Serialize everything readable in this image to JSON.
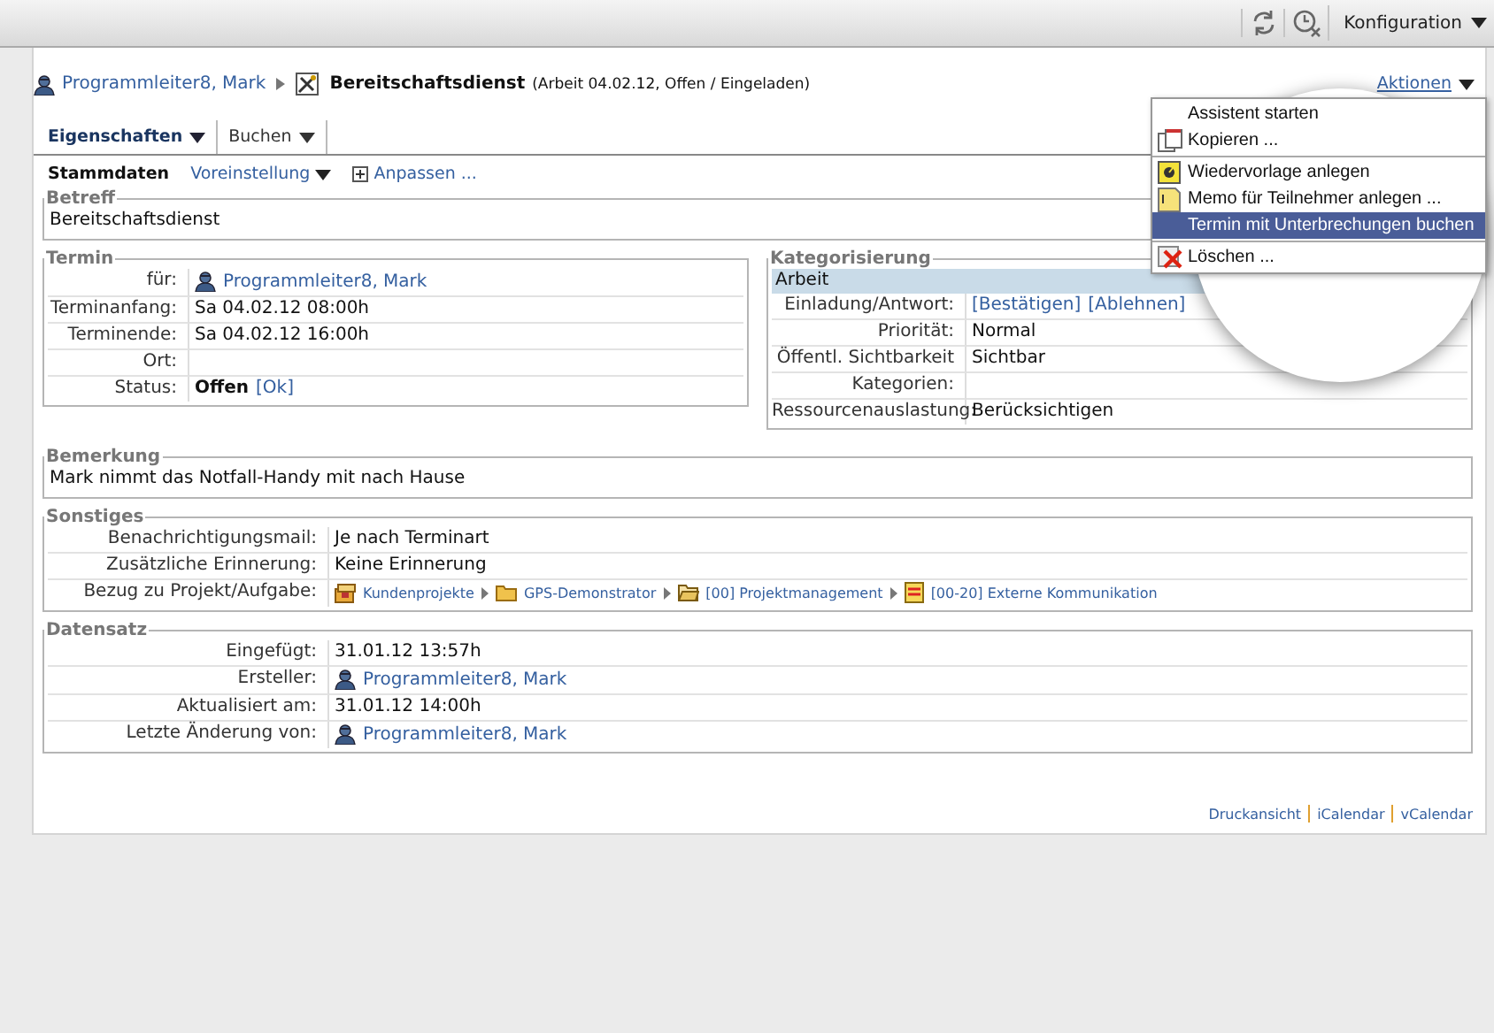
{
  "toolbar": {
    "menu": "Konfiguration"
  },
  "breadcrumb": {
    "person": "Programmleiter8, Mark",
    "title": "Bereitschaftsdienst",
    "details": "(Arbeit 04.02.12, Offen / Eingeladen)"
  },
  "actions": {
    "label": "Aktionen",
    "menu": [
      {
        "label": "Assistent starten",
        "kind": "plain",
        "selected": false
      },
      {
        "label": "Kopieren ...",
        "kind": "copy",
        "selected": false
      },
      {
        "label": "Wiedervorlage anlegen",
        "kind": "resubmit",
        "selected": false
      },
      {
        "label": "Memo für Teilnehmer anlegen ...",
        "kind": "memo",
        "selected": false
      },
      {
        "label": "Termin mit Unterbrechungen buchen",
        "kind": "plain",
        "selected": true
      },
      {
        "label": "Löschen ...",
        "kind": "delete",
        "selected": false
      }
    ]
  },
  "tabs": [
    {
      "label": "Eigenschaften",
      "selected": true
    },
    {
      "label": "Buchen",
      "selected": false
    }
  ],
  "subtabs": [
    {
      "label": "Stammdaten",
      "kind": "plain",
      "selected": true
    },
    {
      "label": "Voreinstellung",
      "kind": "dropdown",
      "selected": false
    },
    {
      "label": "Anpassen ...",
      "kind": "plus",
      "selected": false
    }
  ],
  "betreff": {
    "legend": "Betreff",
    "text": "Bereitschaftsdienst"
  },
  "termin": {
    "legend": "Termin",
    "rows": [
      {
        "label": "für:",
        "value": [
          {
            "kind": "person",
            "text": "Programmleiter8, Mark"
          }
        ]
      },
      {
        "label": "Terminanfang:",
        "value": [
          {
            "kind": "text",
            "text": "Sa 04.02.12 08:00h"
          }
        ]
      },
      {
        "label": "Terminende:",
        "value": [
          {
            "kind": "text",
            "text": "Sa 04.02.12 16:00h"
          }
        ]
      },
      {
        "label": "Ort:",
        "value": []
      },
      {
        "label": "Status:",
        "value": [
          {
            "kind": "bold",
            "text": "Offen"
          },
          {
            "kind": "link",
            "text": "[Ok]"
          }
        ]
      }
    ]
  },
  "kategorisierung": {
    "legend": "Kategorisierung",
    "header": "Arbeit",
    "rows": [
      {
        "label": "Einladung/Antwort:",
        "value": [
          {
            "kind": "link",
            "text": "[Bestätigen]"
          },
          {
            "kind": "link",
            "text": "[Ablehnen]"
          }
        ]
      },
      {
        "label": "Priorität:",
        "value": [
          {
            "kind": "text",
            "text": "Normal"
          }
        ]
      },
      {
        "label": "Öffentl. Sichtbarkeit",
        "value": [
          {
            "kind": "text",
            "text": "Sichtbar"
          }
        ]
      },
      {
        "label": "Kategorien:",
        "value": []
      },
      {
        "label": "Ressourcenauslastung:",
        "value": [
          {
            "kind": "text",
            "text": "Berücksichtigen"
          }
        ]
      }
    ]
  },
  "bemerkung": {
    "legend": "Bemerkung",
    "text": "Mark nimmt das Notfall-Handy mit nach Hause"
  },
  "sonstiges": {
    "legend": "Sonstiges",
    "rows": [
      {
        "label": "Benachrichtigungsmail:",
        "value": [
          {
            "kind": "text",
            "text": "Je nach Terminart"
          }
        ]
      },
      {
        "label": "Zusätzliche Erinnerung:",
        "value": [
          {
            "kind": "text",
            "text": "Keine Erinnerung"
          }
        ]
      },
      {
        "label": "Bezug zu Projekt/Aufgabe:",
        "value": [
          {
            "kind": "project",
            "text": "Kundenprojekte"
          },
          {
            "kind": "folder",
            "text": "GPS-Demonstrator"
          },
          {
            "kind": "openfolder",
            "text": "[00] Projektmanagement"
          },
          {
            "kind": "task",
            "text": "[00-20] Externe Kommunikation"
          }
        ]
      }
    ]
  },
  "datensatz": {
    "legend": "Datensatz",
    "rows": [
      {
        "label": "Eingefügt:",
        "value": [
          {
            "kind": "text",
            "text": "31.01.12   13:57h"
          }
        ]
      },
      {
        "label": "Ersteller:",
        "value": [
          {
            "kind": "person",
            "text": "Programmleiter8, Mark"
          }
        ]
      },
      {
        "label": "Aktualisiert am:",
        "value": [
          {
            "kind": "text",
            "text": "31.01.12   14:00h"
          }
        ]
      },
      {
        "label": "Letzte Änderung von:",
        "value": [
          {
            "kind": "person",
            "text": "Programmleiter8, Mark"
          }
        ]
      }
    ]
  },
  "footer_links": [
    "Druckansicht",
    "iCalendar",
    "vCalendar"
  ]
}
